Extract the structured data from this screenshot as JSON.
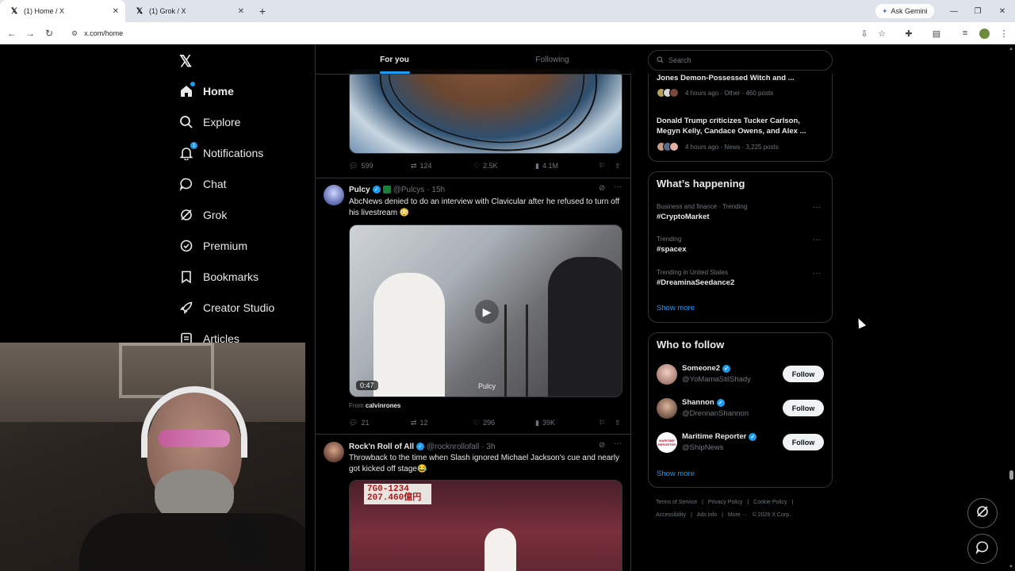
{
  "browser": {
    "tabs": [
      {
        "title": "(1) Home / X",
        "active": true
      },
      {
        "title": "(1) Grok / X",
        "active": false
      }
    ],
    "ask_gemini": "Ask Gemini",
    "url": "x.com/home"
  },
  "sidebar": {
    "logo": "𝕏",
    "items": [
      {
        "label": "Home",
        "icon": "home-icon"
      },
      {
        "label": "Explore",
        "icon": "search-icon"
      },
      {
        "label": "Notifications",
        "icon": "bell-icon",
        "badge": "1"
      },
      {
        "label": "Chat",
        "icon": "chat-icon"
      },
      {
        "label": "Grok",
        "icon": "grok-icon"
      },
      {
        "label": "Premium",
        "icon": "premium-icon"
      },
      {
        "label": "Bookmarks",
        "icon": "bookmark-icon"
      },
      {
        "label": "Creator Studio",
        "icon": "rocket-icon"
      },
      {
        "label": "Articles",
        "icon": "article-icon"
      }
    ]
  },
  "feed": {
    "tabs": [
      "For you",
      "Following"
    ],
    "post0_actions": {
      "replies": "599",
      "reposts": "124",
      "likes": "2.5K",
      "views": "4.1M"
    },
    "post1": {
      "name": "Pulcy",
      "handle": "@Pulcys",
      "time": "· 15h",
      "text": "AbcNews denied to do an interview with Clavicular after he refused to turn off his livestream 😳",
      "duration": "0:47",
      "watermark": "Pulcy",
      "from_label": "From",
      "from_user": "calvinrones",
      "replies": "21",
      "reposts": "12",
      "likes": "296",
      "views": "39K"
    },
    "post2": {
      "name": "Rock'n Roll of All",
      "handle": "@rocknrollofall",
      "time": "· 3h",
      "text": "Throwback to the time when Slash ignored Michael Jackson's cue and nearly got kicked off stage😂",
      "sign": "7G0-1234\n207.460億円"
    }
  },
  "right": {
    "search_placeholder": "Search",
    "stories": [
      {
        "title": "Jones Demon-Possessed Witch and ...",
        "meta": "4 hours ago · Other · 460 posts"
      },
      {
        "title": "Donald Trump criticizes Tucker Carlson, Megyn Kelly, Candace Owens, and Alex ...",
        "meta": "4 hours ago · News · 3,225 posts"
      }
    ],
    "whats_happening": {
      "title": "What’s happening",
      "trends": [
        {
          "context": "Business and finance · Trending",
          "name": "#CryptoMarket"
        },
        {
          "context": "Trending",
          "name": "#spacex"
        },
        {
          "context": "Trending in United States",
          "name": "#DreaminaSeedance2"
        }
      ],
      "show_more": "Show more"
    },
    "who_to_follow": {
      "title": "Who to follow",
      "users": [
        {
          "name": "Someone2",
          "handle": "@YoMamaStilShady",
          "button": "Follow"
        },
        {
          "name": "Shannon",
          "handle": "@DrennanShannon",
          "button": "Follow"
        },
        {
          "name": "Maritime Reporter",
          "handle": "@ShipNews",
          "button": "Follow",
          "avatar_text": "MARITIME REPORTER"
        }
      ],
      "show_more": "Show more"
    },
    "footer": {
      "links": [
        "Terms of Service",
        "Privacy Policy",
        "Cookie Policy",
        "Accessibility",
        "Ads info",
        "More ···"
      ],
      "copyright": "© 2026 X Corp."
    }
  }
}
